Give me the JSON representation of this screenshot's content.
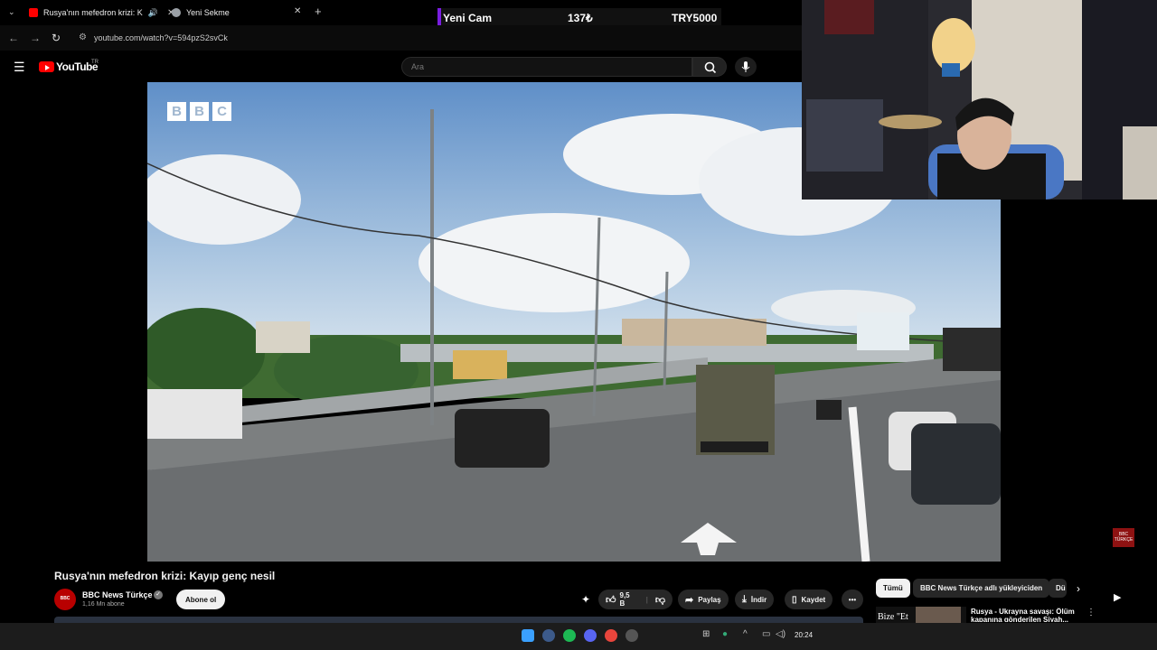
{
  "tabs": [
    {
      "label": "Rusya'nın mefedron krizi: K",
      "favicon": "youtube-icon"
    },
    {
      "label": "Yeni Sekme",
      "favicon": "chrome-icon"
    }
  ],
  "address": {
    "url": "youtube.com/watch?v=594pzS2svCk"
  },
  "youtube": {
    "logo_text": "YouTube",
    "region": "TR",
    "search_placeholder": "Ara"
  },
  "overlay": {
    "label": "Yeni Cam",
    "count": "137₺",
    "total": "TRY5000"
  },
  "video": {
    "watermark": "BBC",
    "corner_badge_line1": "BBC",
    "corner_badge_line2": "TÜRKÇE"
  },
  "meta": {
    "title": "Rusya'nın mefedron krizi: Kayıp genç nesil",
    "channel": "BBC News Türkçe",
    "subscribers": "1,16 Mn abone",
    "subscribe_label": "Abone ol",
    "likes": "9,5 B",
    "share_label": "Paylaş",
    "download_label": "İndir",
    "save_label": "Kaydet"
  },
  "chips": [
    "Tümü",
    "BBC News Türkçe adlı yükleyiciden",
    "Dü"
  ],
  "related": {
    "thumb_text": "Bize \"Et",
    "title": "Rusya - Ukrayna savaşı: Ölüm kapanına gönderilen Siyah..."
  },
  "taskbar": {
    "time": "20:24"
  },
  "colors": {
    "youtube_red": "#ff0000",
    "overlay_accent": "#7a1de0",
    "bbc_red": "#b80000"
  }
}
